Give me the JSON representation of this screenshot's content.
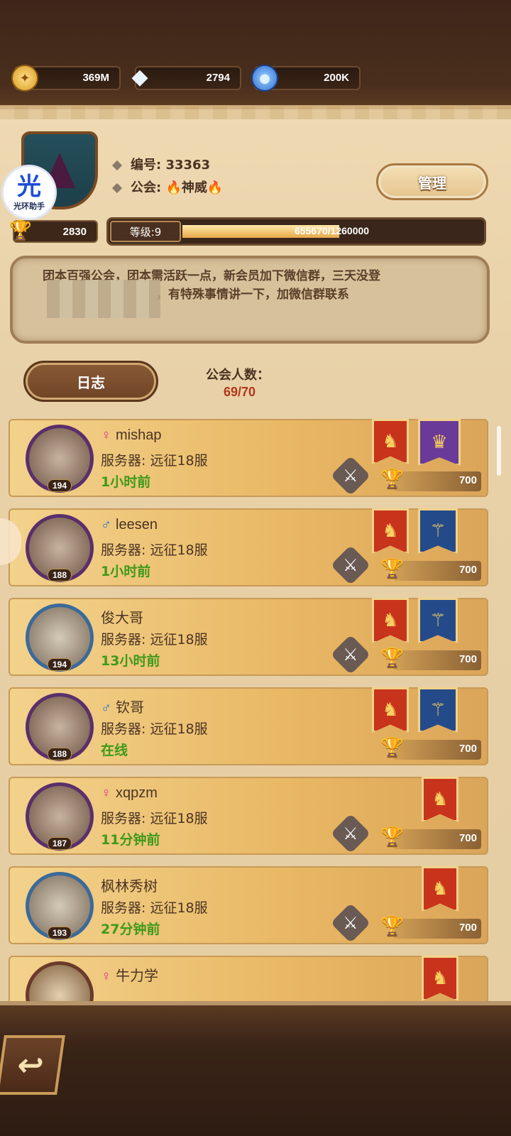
{
  "currencies": [
    {
      "icon": "gold-coin-icon",
      "value": "369M"
    },
    {
      "icon": "diamond-icon",
      "value": "2794"
    },
    {
      "icon": "crystal-icon",
      "value": "200K"
    }
  ],
  "watermark": {
    "big": "光",
    "small": "光环助手"
  },
  "guild": {
    "id_label": "编号: 33363",
    "name_label": "公会: ",
    "name": "神威",
    "manage_label": "管理",
    "trophies": "2830",
    "level_label": "等级:9",
    "exp_text": "655670/1260000",
    "exp_fraction": 0.52,
    "notice_line1": "团本百强公会，团本需活跃一点，新会员加下微信群，三天没登",
    "notice_line2": "，有特殊事情讲一下，加微信群联系",
    "log_label": "日志",
    "member_count_label": "公会人数：",
    "member_count": "69/70"
  },
  "members": [
    {
      "name": "mishap",
      "gender": "female",
      "server": "服务器: 远征18服",
      "time": "1小时前",
      "level": "194",
      "trophies": "700",
      "banners": [
        "red",
        "purple"
      ],
      "swords": true,
      "avatar": "purple"
    },
    {
      "name": "leesen",
      "gender": "male",
      "server": "服务器: 远征18服",
      "time": "1小时前",
      "level": "188",
      "trophies": "700",
      "banners": [
        "red",
        "blue"
      ],
      "swords": true,
      "avatar": "purple"
    },
    {
      "name": "俊大哥",
      "gender": "",
      "server": "服务器: 远征18服",
      "time": "13小时前",
      "level": "194",
      "trophies": "700",
      "banners": [
        "red",
        "blue"
      ],
      "swords": true,
      "avatar": "blue"
    },
    {
      "name": "钦哥",
      "gender": "male",
      "server": "服务器: 远征18服",
      "time": "在线",
      "level": "188",
      "trophies": "700",
      "banners": [
        "red",
        "blue"
      ],
      "swords": false,
      "avatar": "purple"
    },
    {
      "name": "xqpzm",
      "gender": "female",
      "server": "服务器: 远征18服",
      "time": "11分钟前",
      "level": "187",
      "trophies": "700",
      "banners": [
        "red"
      ],
      "swords": true,
      "avatar": "purple"
    },
    {
      "name": "枫林秀树",
      "gender": "",
      "server": "服务器: 远征18服",
      "time": "27分钟前",
      "level": "193",
      "trophies": "700",
      "banners": [
        "red"
      ],
      "swords": true,
      "avatar": "blue"
    },
    {
      "name": "牛力学",
      "gender": "female",
      "server": "",
      "time": "",
      "level": "",
      "trophies": "",
      "banners": [
        "red"
      ],
      "swords": false,
      "avatar": "brown"
    }
  ],
  "colors": {
    "online_green": "#3e9a1a",
    "female_pink": "#e0338a",
    "male_blue": "#2a6fd6",
    "count_red": "#b0361c"
  }
}
